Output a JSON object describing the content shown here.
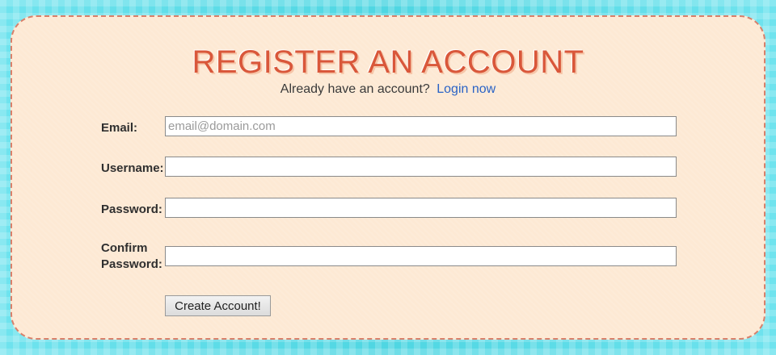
{
  "header": {
    "title": "REGISTER AN ACCOUNT",
    "subtitle_text": "Already have an account?",
    "login_link": "Login now"
  },
  "form": {
    "fields": [
      {
        "label": "Email:",
        "placeholder": "email@domain.com",
        "value": ""
      },
      {
        "label": "Username:",
        "placeholder": "",
        "value": ""
      },
      {
        "label": "Password:",
        "placeholder": "",
        "value": ""
      },
      {
        "label_line1": "Confirm",
        "label_line2": "Password:",
        "placeholder": "",
        "value": ""
      }
    ],
    "submit_label": "Create Account!"
  },
  "colors": {
    "background": "#5ad9e4",
    "panel": "#fde9d4",
    "title": "#d9573a",
    "link": "#2a63c6",
    "border_dashed": "#d9806a"
  }
}
